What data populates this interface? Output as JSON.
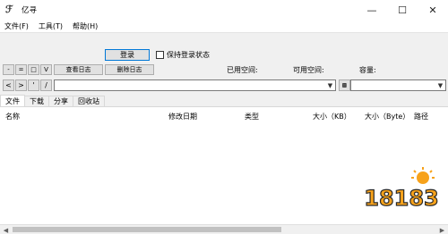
{
  "window": {
    "title": "亿寻",
    "app_icon": "feather-logo-icon"
  },
  "menu": [
    "文件(F)",
    "工具(T)",
    "帮助(H)"
  ],
  "login": {
    "button": "登录",
    "keep_login": "保持登录状态"
  },
  "toolbar": {
    "small_buttons": [
      "-",
      "=",
      "□",
      "V"
    ],
    "view_log": "查看日志",
    "delete_log": "删除日志",
    "used_space": "已用空间:",
    "free_space": "可用空间:",
    "capacity": "容量:"
  },
  "nav": {
    "back": "<",
    "forward": ">",
    "dot": "'",
    "up": "/"
  },
  "tabs": [
    "文件",
    "下载",
    "分享",
    "回收站"
  ],
  "columns": [
    "名称",
    "修改日期",
    "类型",
    "大小（KB）",
    "大小（Byte）",
    "路径"
  ],
  "watermark": {
    "text": "18183"
  }
}
